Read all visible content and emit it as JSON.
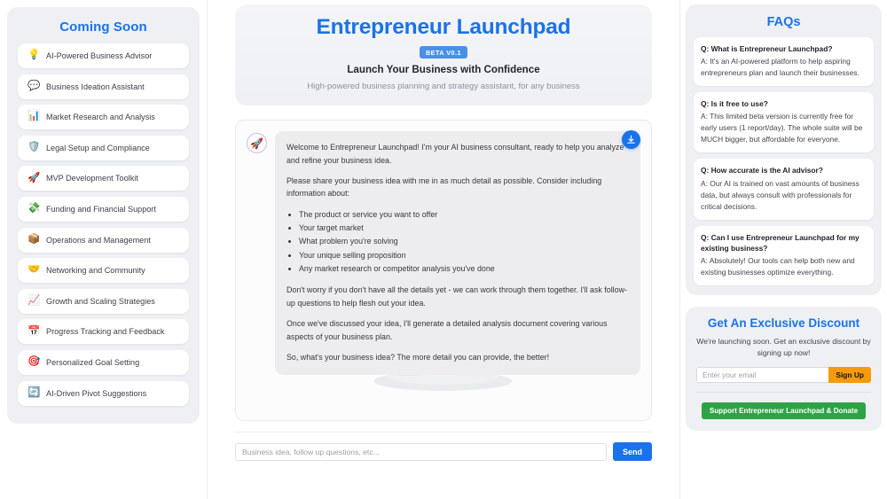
{
  "sidebar": {
    "title": "Coming Soon",
    "items": [
      {
        "icon": "lightbulb-icon",
        "glyph": "💡",
        "label": "AI-Powered Business Advisor"
      },
      {
        "icon": "speech-bubble-icon",
        "glyph": "💬",
        "label": "Business Ideation Assistant"
      },
      {
        "icon": "bar-chart-icon",
        "glyph": "📊",
        "label": "Market Research and Analysis"
      },
      {
        "icon": "shield-icon",
        "glyph": "🛡️",
        "label": "Legal Setup and Compliance"
      },
      {
        "icon": "rocket-icon",
        "glyph": "🚀",
        "label": "MVP Development Toolkit"
      },
      {
        "icon": "money-wings-icon",
        "glyph": "💸",
        "label": "Funding and Financial Support"
      },
      {
        "icon": "package-icon",
        "glyph": "📦",
        "label": "Operations and Management"
      },
      {
        "icon": "handshake-icon",
        "glyph": "🤝",
        "label": "Networking and Community"
      },
      {
        "icon": "chart-increasing-icon",
        "glyph": "📈",
        "label": "Growth and Scaling Strategies"
      },
      {
        "icon": "calendar-icon",
        "glyph": "📅",
        "label": "Progress Tracking and Feedback"
      },
      {
        "icon": "target-icon",
        "glyph": "🎯",
        "label": "Personalized Goal Setting"
      },
      {
        "icon": "refresh-arrows-icon",
        "glyph": "🔄",
        "label": "AI-Driven Pivot Suggestions"
      }
    ]
  },
  "hero": {
    "title": "Entrepreneur Launchpad",
    "badge": "BETA V0.1",
    "tagline": "Launch Your Business with Confidence",
    "subtitle": "High-powered business planning and strategy assistant, for any business"
  },
  "chat": {
    "avatar_glyph": "🚀",
    "download_label": "Download report",
    "paragraphs": [
      "Welcome to Entrepreneur Launchpad! I'm your AI business consultant, ready to help you analyze and refine your business idea.",
      "Please share your business idea with me in as much detail as possible. Consider including information about:"
    ],
    "bullets": [
      "The product or service you want to offer",
      "Your target market",
      "What problem you're solving",
      "Your unique selling proposition",
      "Any market research or competitor analysis you've done"
    ],
    "paragraphs_after": [
      "Don't worry if you don't have all the details yet - we can work through them together. I'll ask follow-up questions to help flesh out your idea.",
      "Once we've discussed your idea, I'll generate a detailed analysis document covering various aspects of your business plan.",
      "So, what's your business idea? The more detail you can provide, the better!"
    ],
    "input_placeholder": "Business idea, follow up questions, etc...",
    "input_value": "",
    "send_label": "Send"
  },
  "faq": {
    "title": "FAQs",
    "items": [
      {
        "question": "Q: What is Entrepreneur Launchpad?",
        "answer": "A: It's an AI-powered platform to help aspiring entrepreneurs plan and launch their businesses."
      },
      {
        "question": "Q: Is it free to use?",
        "answer": "A: This limited beta version is currently free for early users (1 report/day). The whole suite will be MUCH bigger, but affordable for everyone."
      },
      {
        "question": "Q: How accurate is the AI advisor?",
        "answer": "A: Our AI is trained on vast amounts of business data, but always consult with professionals for critical decisions."
      },
      {
        "question": "Q: Can I use Entrepreneur Launchpad for my existing business?",
        "answer": "A: Absolutely! Our tools can help both new and existing businesses optimize everything."
      }
    ]
  },
  "promo": {
    "title": "Get An Exclusive Discount",
    "subtitle": "We're launching soon. Get an exclusive discount by signing up now!",
    "email_placeholder": "Enter your email",
    "email_value": "",
    "signup_label": "Sign Up",
    "donate_label": "Support Entrepreneur Launchpad & Donate"
  },
  "colors": {
    "accent_blue": "#1a73e8",
    "badge_blue": "#4a90e8",
    "signup_orange": "#f59b0b",
    "donate_green": "#2da345",
    "panel_gray": "#eef0f4",
    "bubble_gray": "#ededef"
  }
}
